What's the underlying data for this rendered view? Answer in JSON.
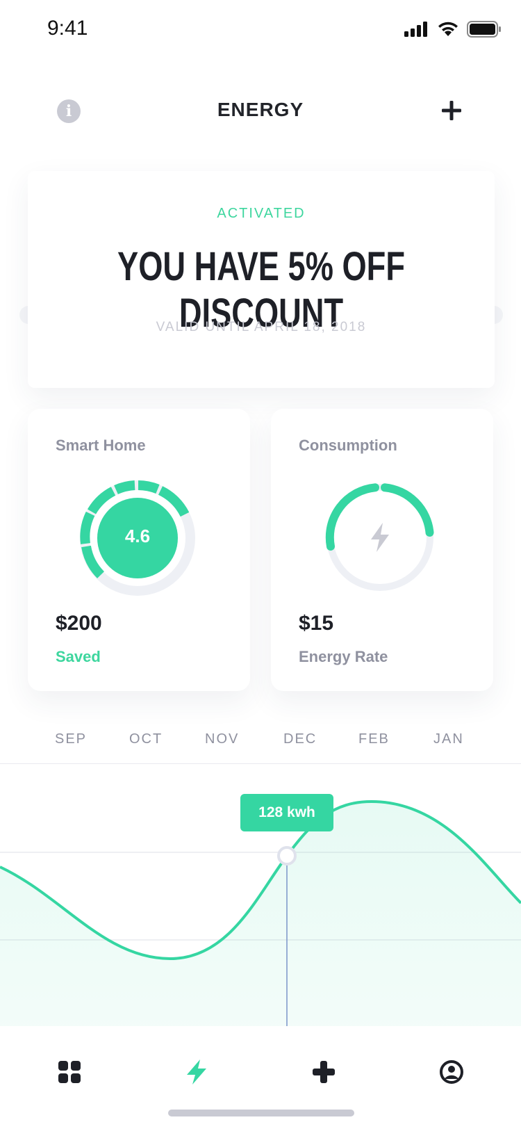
{
  "status_bar": {
    "time": "9:41"
  },
  "header": {
    "title": "ENERGY",
    "info_icon": "info-icon",
    "add_icon": "plus-icon"
  },
  "promo": {
    "status": "ACTIVATED",
    "headline": "YOU HAVE 5% OFF DISCOUNT",
    "valid_until": "VALID UNTIL APRIL 18, 2018"
  },
  "cards": {
    "smart_home": {
      "title": "Smart Home",
      "score": "4.6",
      "value": "$200",
      "subtitle": "Saved"
    },
    "consumption": {
      "title": "Consumption",
      "value": "$15",
      "subtitle": "Energy Rate",
      "icon": "lightning-icon"
    }
  },
  "months": [
    "SEP",
    "OCT",
    "NOV",
    "DEC",
    "FEB",
    "JAN"
  ],
  "chart_data": {
    "type": "area",
    "tooltip": "128 kwh"
  },
  "tabbar": {
    "items": [
      "dashboard-icon",
      "lightning-icon",
      "plus-icon",
      "profile-icon"
    ],
    "active": "lightning-icon"
  },
  "colors": {
    "accent": "#35d6a2",
    "text_dark": "#1e2027",
    "text_grey": "#8f919f",
    "muted": "#c9cad3"
  }
}
